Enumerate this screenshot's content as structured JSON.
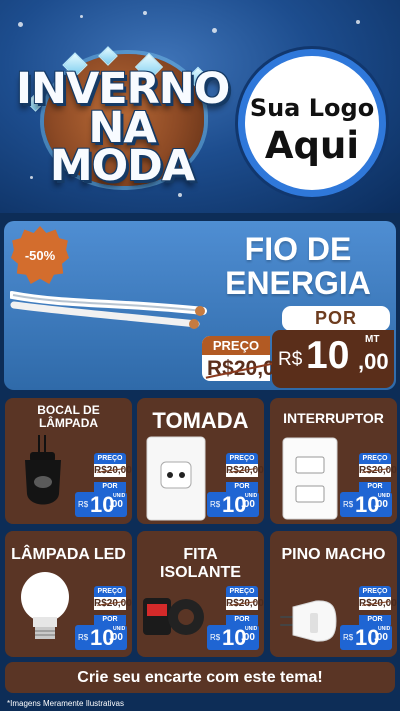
{
  "hero": {
    "headline_line1": "INVERNO",
    "headline_line2": "NA MODA",
    "logo_line1": "Sua Logo",
    "logo_line2": "Aqui"
  },
  "main_offer": {
    "discount": "-50%",
    "title_line1": "FIO DE",
    "title_line2": "ENERGIA",
    "preco_label": "PREÇO",
    "old_price": "R$20,00",
    "por_label": "POR",
    "currency": "R$",
    "price_int": "10",
    "price_dec": ",00",
    "unit": "MT"
  },
  "products": [
    {
      "title": "BOCAL DE\nLÂMPADA",
      "preco_label": "PREÇO",
      "old": "R$20,00",
      "por": "POR",
      "currency": "R$",
      "int": "10",
      "dec": ",00",
      "unit": "UNID"
    },
    {
      "title": "TOMADA",
      "preco_label": "PREÇO",
      "old": "R$20,00",
      "por": "POR",
      "currency": "R$",
      "int": "10",
      "dec": ",00",
      "unit": "UNID"
    },
    {
      "title": "INTERRUPTOR",
      "preco_label": "PREÇO",
      "old": "R$20,00",
      "por": "POR",
      "currency": "R$",
      "int": "10",
      "dec": ",00",
      "unit": "UNID"
    },
    {
      "title": "LÂMPADA LED",
      "preco_label": "PREÇO",
      "old": "R$20,00",
      "por": "POR",
      "currency": "R$",
      "int": "10",
      "dec": ",00",
      "unit": "UNID"
    },
    {
      "title": "FITA ISOLANTE",
      "preco_label": "PREÇO",
      "old": "R$20,00",
      "por": "POR",
      "currency": "R$",
      "int": "10",
      "dec": ",00",
      "unit": "UNID"
    },
    {
      "title": "PINO MACHO",
      "preco_label": "PREÇO",
      "old": "R$20,00",
      "por": "POR",
      "currency": "R$",
      "int": "10",
      "dec": ",00",
      "unit": "UNID"
    }
  ],
  "cta": "Crie seu encarte com este tema!",
  "disclaimer": "*Imagens Meramente Ilustrativas",
  "colors": {
    "brown": "#5a3525",
    "blue": "#1f65d3",
    "panel_blue": "#4f8ed3"
  }
}
